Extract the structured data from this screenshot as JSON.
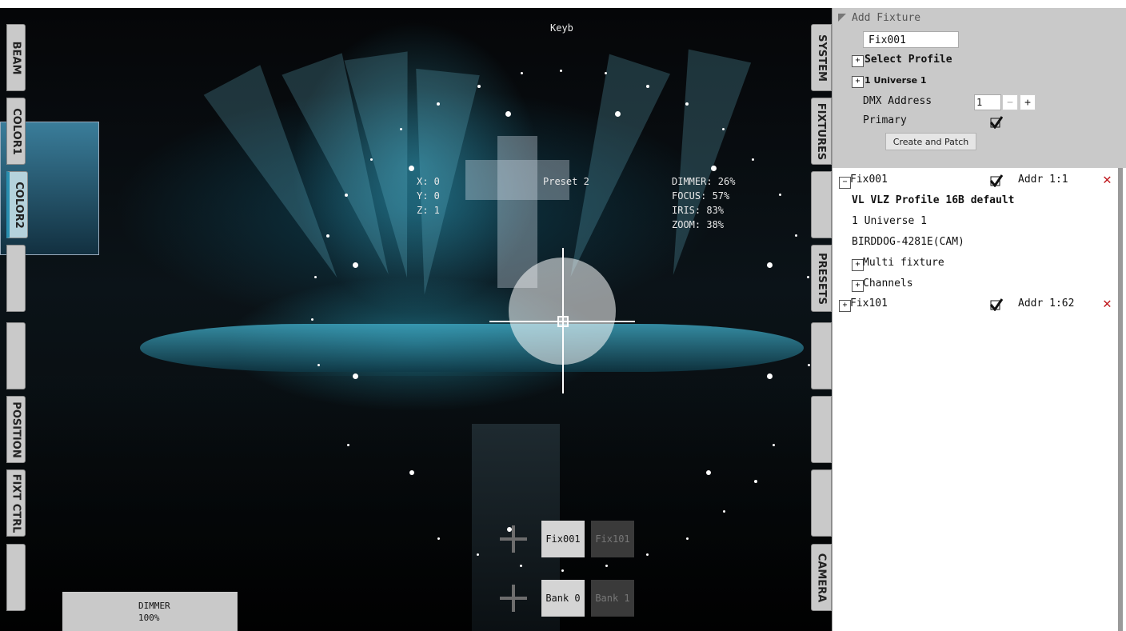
{
  "viewport": {
    "keyboard_label": "Keyb",
    "position": {
      "x": "X: 0",
      "y": "Y: 0",
      "z": "Z: 1"
    },
    "preset_label": "Preset 2",
    "params": {
      "dimmer": "DIMMER: 26%",
      "focus": "FOCUS: 57%",
      "iris": "IRIS: 83%",
      "zoom": "ZOOM: 38%"
    },
    "fixture_buttons": [
      "Fix001",
      "Fix101"
    ],
    "bank_buttons": [
      "Bank 0",
      "Bank 1"
    ],
    "dimmer_readout": {
      "label": "DIMMER",
      "value": "100%"
    }
  },
  "left_tabs": [
    "BEAM",
    "COLOR1",
    "COLOR2",
    "",
    "",
    "POSITION",
    "FIXT CTRL",
    ""
  ],
  "right_tabs": [
    "SYSTEM",
    "FIXTURES",
    "",
    "PRESETS",
    "",
    "",
    "",
    "CAMERA"
  ],
  "add_fixture": {
    "header": "Add Fixture",
    "name_value": "Fix001",
    "select_profile": "Select Profile",
    "universe": "1 Universe 1",
    "dmx_label": "DMX Address",
    "dmx_value": "1",
    "minus": "−",
    "plus": "+",
    "primary_label": "Primary",
    "create_button": "Create and Patch"
  },
  "fixtures": [
    {
      "name": "Fix001",
      "expander": "−",
      "addr": "Addr 1:1",
      "details": [
        "VL VLZ Profile 16B default",
        "1 Universe 1",
        "BIRDDOG-4281E(CAM)"
      ],
      "subgroups": [
        "Multi fixture",
        "Channels"
      ]
    },
    {
      "name": "Fix101",
      "expander": "+",
      "addr": "Addr 1:62"
    }
  ],
  "icons": {
    "expand": "+",
    "collapse": "−",
    "remove": "✕",
    "check": "check-icon"
  },
  "colors": {
    "accent": "#2a8fb0",
    "delete": "#c0171c",
    "panel_gray": "#c9c9c9"
  }
}
